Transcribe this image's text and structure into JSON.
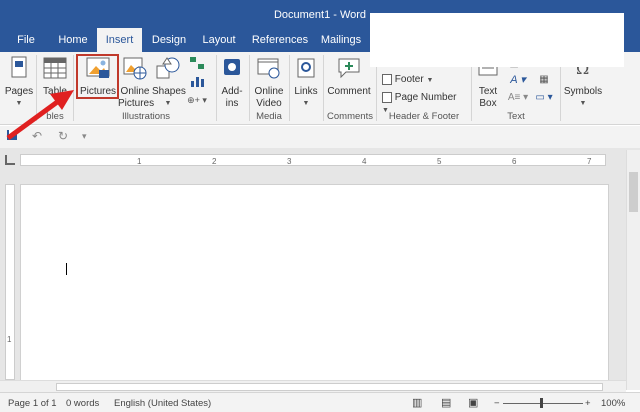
{
  "window": {
    "title": "Document1 - Word"
  },
  "tabs": [
    {
      "label": "File"
    },
    {
      "label": "Home"
    },
    {
      "label": "Insert"
    },
    {
      "label": "Design"
    },
    {
      "label": "Layout"
    },
    {
      "label": "References"
    },
    {
      "label": "Mailings"
    }
  ],
  "ribbon": {
    "pages": "Pages",
    "table": "Table",
    "pictures": "Pictures",
    "online_pictures_1": "Online",
    "online_pictures_2": "Pictures",
    "shapes": "Shapes",
    "addins_1": "Add-",
    "addins_2": "ins",
    "online_video_1": "Online",
    "online_video_2": "Video",
    "links": "Links",
    "comment": "Comment",
    "footer": "Footer",
    "page_number": "Page Number",
    "text_box_1": "Text",
    "text_box_2": "Box",
    "symbols": "Symbols",
    "groups": {
      "tables": "bles",
      "illustrations": "Illustrations",
      "media": "Media",
      "comments": "Comments",
      "header_footer": "Header & Footer",
      "text": "Text"
    }
  },
  "ruler_numbers": [
    "1",
    "2",
    "3",
    "4",
    "5",
    "6",
    "7"
  ],
  "vruler_numbers": [
    "1"
  ],
  "status": {
    "page": "Page 1 of 1",
    "words": "0 words",
    "language": "English (United States)",
    "zoom": "100%",
    "zoom_minus": "−",
    "zoom_plus": "+"
  },
  "colors": {
    "accent": "#2b579a",
    "highlight": "#c0392b"
  },
  "icons": [
    "save-icon",
    "undo-icon",
    "redo-icon",
    "customize-qat-icon"
  ]
}
